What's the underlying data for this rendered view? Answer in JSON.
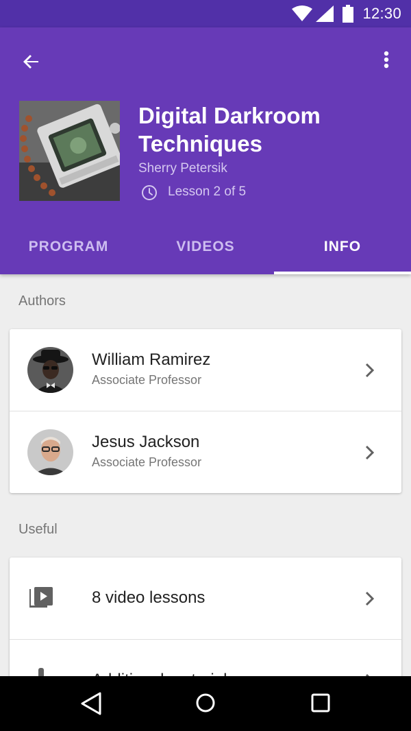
{
  "status_bar": {
    "time": "12:30"
  },
  "course": {
    "title": "Digital Darkroom Techniques",
    "author": "Sherry Petersik",
    "lesson_progress": "Lesson 2 of 5"
  },
  "tabs": [
    {
      "label": "PROGRAM",
      "active": false
    },
    {
      "label": "VIDEOS",
      "active": false
    },
    {
      "label": "INFO",
      "active": true
    }
  ],
  "authors_section": {
    "label": "Authors",
    "items": [
      {
        "name": "William Ramirez",
        "role": "Associate Professor"
      },
      {
        "name": "Jesus Jackson",
        "role": "Associate Professor"
      }
    ]
  },
  "useful_section": {
    "label": "Useful",
    "items": [
      {
        "label": "8 video lessons",
        "icon": "video-library-icon"
      },
      {
        "label": "Additional materials",
        "icon": "attachment-icon"
      }
    ]
  },
  "colors": {
    "primary": "#673ab7",
    "primary_dark": "#5130a8",
    "background": "#eeeeee"
  }
}
